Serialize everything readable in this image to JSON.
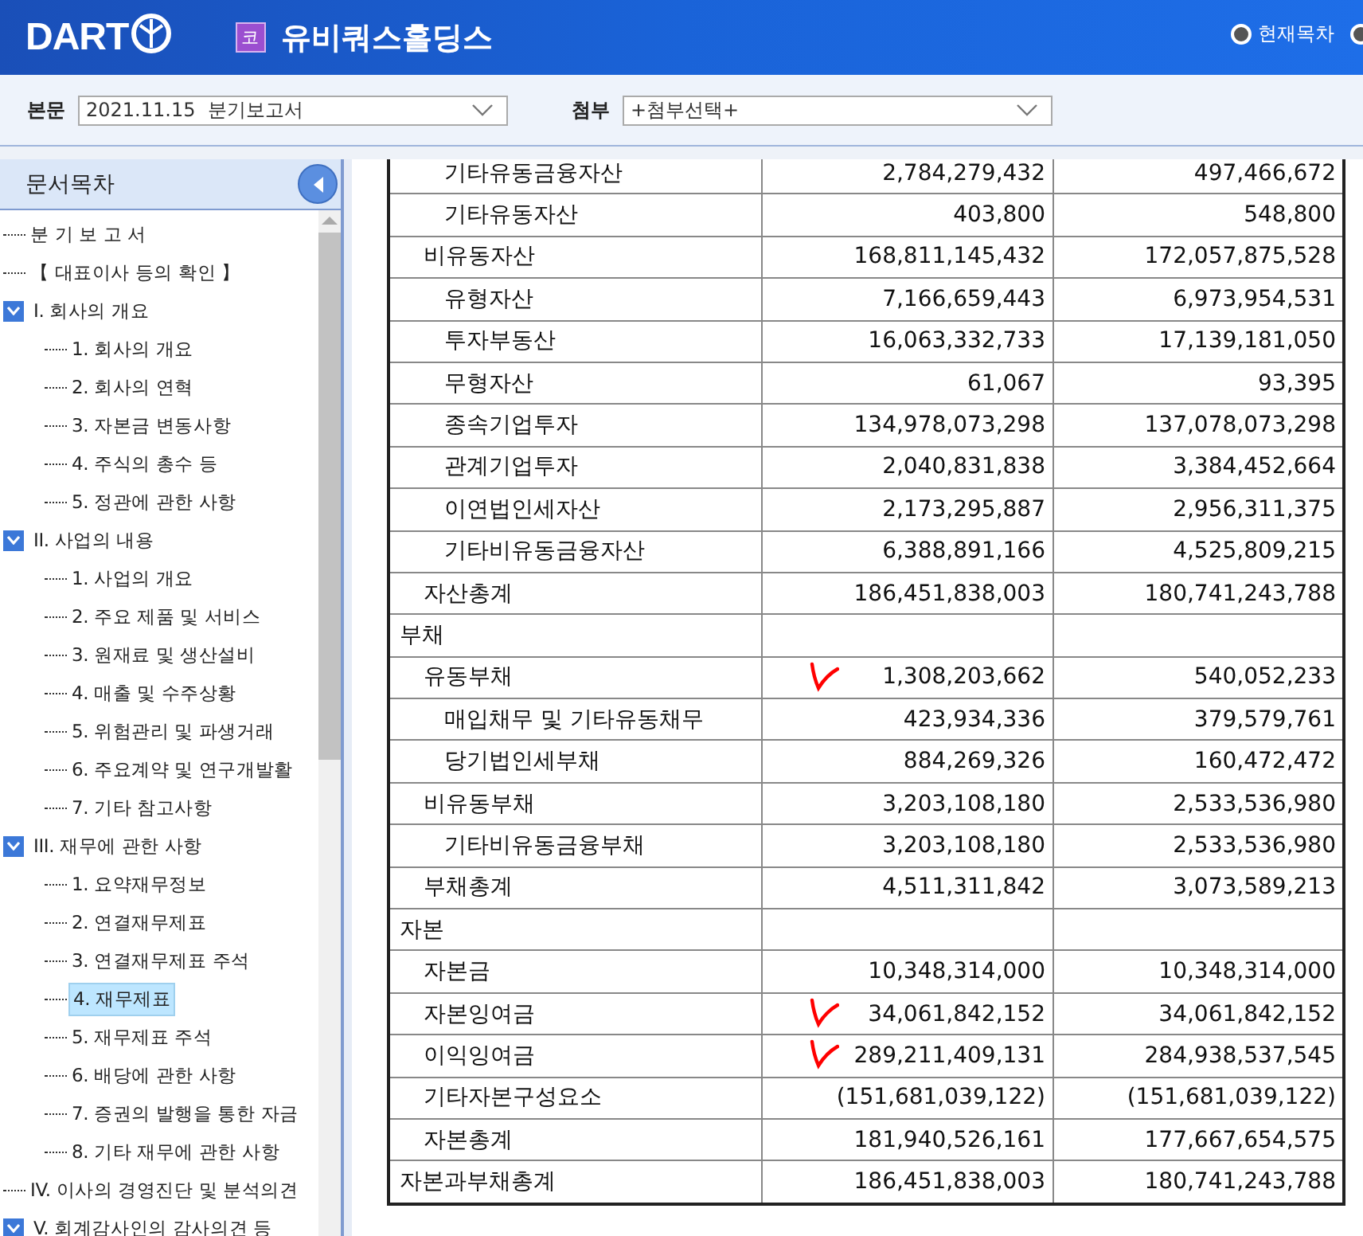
{
  "header": {
    "logo": "DART",
    "market_badge": "코",
    "company": "유비쿼스홀딩스",
    "view_options": [
      {
        "label": "현재목차",
        "selected": false
      },
      {
        "selected": false
      }
    ]
  },
  "toolbar": {
    "main_label": "본문",
    "main_value": "2021.11.15  분기보고서",
    "attach_label": "첨부",
    "attach_value": "+첨부선택+"
  },
  "sidebar": {
    "title": "문서목차",
    "items": [
      {
        "label": "분 기 보 고 서",
        "selected": false
      },
      {
        "label": "【 대표이사 등의 확인 】",
        "selected": false
      },
      {
        "label": "I. 회사의 개요",
        "selected": false,
        "expanded": true,
        "children": [
          {
            "label": "1. 회사의 개요",
            "selected": false
          },
          {
            "label": "2. 회사의 연혁",
            "selected": false
          },
          {
            "label": "3. 자본금 변동사항",
            "selected": false
          },
          {
            "label": "4. 주식의 총수 등",
            "selected": false
          },
          {
            "label": "5. 정관에 관한 사항",
            "selected": false
          }
        ]
      },
      {
        "label": "II. 사업의 내용",
        "selected": false,
        "expanded": true,
        "children": [
          {
            "label": "1. 사업의 개요",
            "selected": false
          },
          {
            "label": "2. 주요 제품 및 서비스",
            "selected": false
          },
          {
            "label": "3. 원재료 및 생산설비",
            "selected": false
          },
          {
            "label": "4. 매출 및 수주상황",
            "selected": false
          },
          {
            "label": "5. 위험관리 및 파생거래",
            "selected": false
          },
          {
            "label": "6. 주요계약 및 연구개발활",
            "selected": false
          },
          {
            "label": "7. 기타 참고사항",
            "selected": false
          }
        ]
      },
      {
        "label": "III. 재무에 관한 사항",
        "selected": false,
        "expanded": true,
        "children": [
          {
            "label": "1. 요약재무정보",
            "selected": false
          },
          {
            "label": "2. 연결재무제표",
            "selected": false
          },
          {
            "label": "3. 연결재무제표 주석",
            "selected": false
          },
          {
            "label": "4. 재무제표",
            "selected": true
          },
          {
            "label": "5. 재무제표 주석",
            "selected": false
          },
          {
            "label": "6. 배당에 관한 사항",
            "selected": false
          },
          {
            "label": "7. 증권의 발행을 통한 자금",
            "selected": false
          },
          {
            "label": "8. 기타 재무에 관한 사항",
            "selected": false
          }
        ]
      },
      {
        "label": "IV. 이사의 경영진단 및 분석의견",
        "selected": false
      },
      {
        "label": "V. 회계감사인의 감사의견 등",
        "selected": false,
        "expanded": true
      }
    ]
  },
  "table": {
    "rows": [
      {
        "children": [
          {
            "children": [
              {
                "label": "기타유동금융자산",
                "values": [
                  "2,784,279,432",
                  "497,466,672"
                ]
              },
              {
                "label": "기타유동자산",
                "values": [
                  "403,800",
                  "548,800"
                ]
              }
            ]
          },
          {
            "label": "비유동자산",
            "values": [
              "168,811,145,432",
              "172,057,875,528"
            ],
            "children": [
              {
                "label": "유형자산",
                "values": [
                  "7,166,659,443",
                  "6,973,954,531"
                ]
              },
              {
                "label": "투자부동산",
                "values": [
                  "16,063,332,733",
                  "17,139,181,050"
                ]
              },
              {
                "label": "무형자산",
                "values": [
                  "61,067",
                  "93,395"
                ]
              },
              {
                "label": "종속기업투자",
                "values": [
                  "134,978,073,298",
                  "137,078,073,298"
                ]
              },
              {
                "label": "관계기업투자",
                "values": [
                  "2,040,831,838",
                  "3,384,452,664"
                ]
              },
              {
                "label": "이연법인세자산",
                "values": [
                  "2,173,295,887",
                  "2,956,311,375"
                ]
              },
              {
                "label": "기타비유동금융자산",
                "values": [
                  "6,388,891,166",
                  "4,525,809,215"
                ]
              }
            ]
          },
          {
            "label": "자산총계",
            "values": [
              "186,451,838,003",
              "180,741,243,788"
            ]
          }
        ]
      },
      {
        "label": "부채",
        "children": [
          {
            "label": "유동부채",
            "values": [
              "1,308,203,662",
              "540,052,233"
            ],
            "ticked": true,
            "children": [
              {
                "label": "매입채무 및 기타유동채무",
                "values": [
                  "423,934,336",
                  "379,579,761"
                ]
              },
              {
                "label": "당기법인세부채",
                "values": [
                  "884,269,326",
                  "160,472,472"
                ]
              }
            ]
          },
          {
            "label": "비유동부채",
            "values": [
              "3,203,108,180",
              "2,533,536,980"
            ],
            "children": [
              {
                "label": "기타비유동금융부채",
                "values": [
                  "3,203,108,180",
                  "2,533,536,980"
                ]
              }
            ]
          },
          {
            "label": "부채총계",
            "values": [
              "4,511,311,842",
              "3,073,589,213"
            ]
          }
        ]
      },
      {
        "label": "자본",
        "children": [
          {
            "label": "자본금",
            "values": [
              "10,348,314,000",
              "10,348,314,000"
            ]
          },
          {
            "label": "자본잉여금",
            "values": [
              "34,061,842,152",
              "34,061,842,152"
            ],
            "ticked": true
          },
          {
            "label": "이익잉여금",
            "values": [
              "289,211,409,131",
              "284,938,537,545"
            ],
            "ticked": true
          },
          {
            "label": "기타자본구성요소",
            "values": [
              "(151,681,039,122)",
              "(151,681,039,122)"
            ]
          },
          {
            "label": "자본총계",
            "values": [
              "181,940,526,161",
              "177,667,654,575"
            ]
          }
        ]
      },
      {
        "label": "자본과부채총계",
        "values": [
          "186,451,838,003",
          "180,741,243,788"
        ]
      }
    ]
  }
}
